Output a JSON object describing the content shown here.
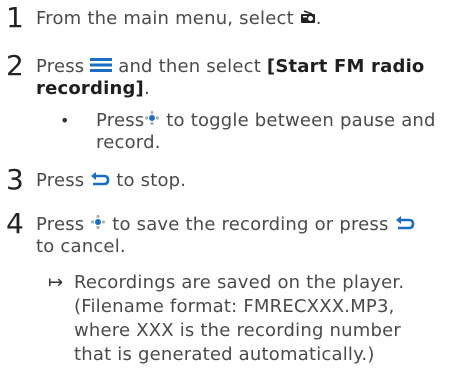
{
  "steps": [
    {
      "number": "1",
      "text_before": "From the main menu, select",
      "icon": "radio-icon",
      "text_after": "."
    },
    {
      "number": "2",
      "text_before": "Press",
      "icon": "menu-icon",
      "text_mid": "and then select",
      "bold_line1": "[Start FM radio",
      "bold_line2": "recording]",
      "text_after": ".",
      "bullet": {
        "marker": "•",
        "text_before": "Press",
        "icon": "play-pause-icon",
        "text_line1": "to toggle between pause and",
        "text_line2": "record."
      }
    },
    {
      "number": "3",
      "text_before": "Press",
      "icon": "back-icon",
      "text_after": "to stop."
    },
    {
      "number": "4",
      "text_before": "Press",
      "icon": "play-pause-icon",
      "text_mid": "to save the recording or press",
      "icon2": "back-icon",
      "text_line2": "to cancel.",
      "result": {
        "marker": "↦",
        "line1": "Recordings are saved on the player.",
        "line2": "(Filename format: FMRECXXX.MP3,",
        "line3": "where XXX is the recording number",
        "line4": "that is generated automatically.)"
      }
    }
  ],
  "colors": {
    "accent": "#1b6ec2",
    "text": "#4a4a4a"
  }
}
